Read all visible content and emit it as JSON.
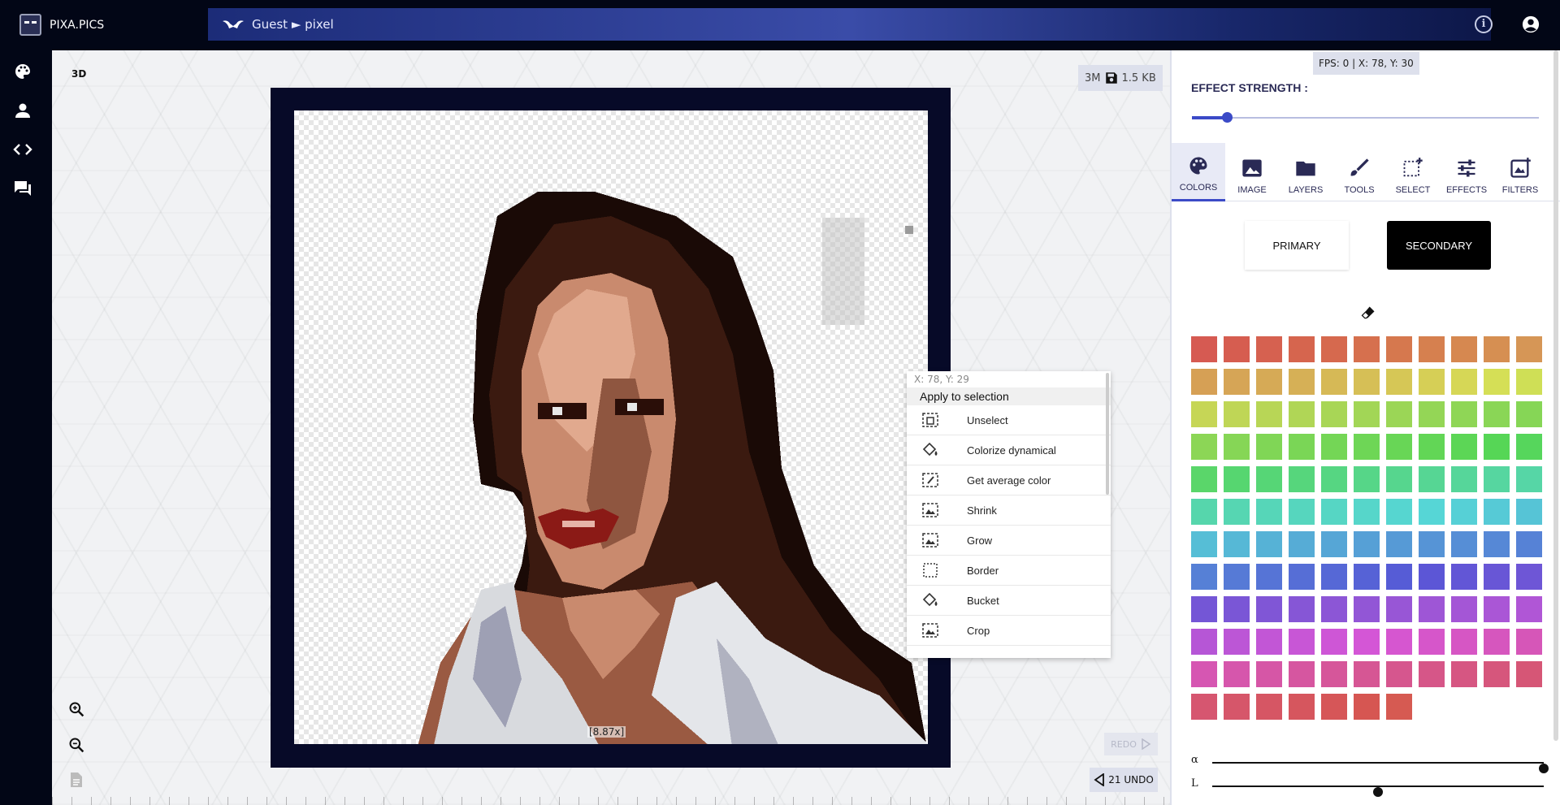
{
  "app": {
    "name": "PIXA.PICS"
  },
  "breadcrumb": {
    "text": "Guest ► pixel"
  },
  "canvas": {
    "mode_3d_label": "3D",
    "size_badge": {
      "prefix": "3M",
      "size": "1.5 KB"
    },
    "zoom_label": "[8.87x]",
    "redo_label": "REDO",
    "undo_label": "21 UNDO"
  },
  "context_menu": {
    "coords": "X: 78, Y: 29",
    "title": "Apply to selection",
    "items": [
      {
        "label": "Unselect",
        "icon": "unselect-icon"
      },
      {
        "label": "Colorize dynamical",
        "icon": "paint-bucket-icon"
      },
      {
        "label": "Get average color",
        "icon": "selection-picker-icon"
      },
      {
        "label": "Shrink",
        "icon": "image-selection-icon"
      },
      {
        "label": "Grow",
        "icon": "image-selection-icon"
      },
      {
        "label": "Border",
        "icon": "dashed-square-icon"
      },
      {
        "label": "Bucket",
        "icon": "paint-bucket-icon"
      },
      {
        "label": "Crop",
        "icon": "image-selection-icon"
      }
    ]
  },
  "panel": {
    "fps_readout": "FPS: 0 | X: 78, Y: 30",
    "effect_strength_label": "EFFECT STRENGTH :",
    "effect_strength_value": 0.1,
    "tabs": [
      {
        "label": "COLORS",
        "icon": "palette-icon",
        "active": true
      },
      {
        "label": "IMAGE",
        "icon": "image-icon",
        "active": false
      },
      {
        "label": "LAYERS",
        "icon": "folder-icon",
        "active": false
      },
      {
        "label": "TOOLS",
        "icon": "brush-icon",
        "active": false
      },
      {
        "label": "SELECT",
        "icon": "select-add-icon",
        "active": false
      },
      {
        "label": "EFFECTS",
        "icon": "tune-icon",
        "active": false
      },
      {
        "label": "FILTERS",
        "icon": "filter-add-icon",
        "active": false
      }
    ],
    "primary_label": "PRIMARY",
    "secondary_label": "SECONDARY",
    "alpha_label": "α",
    "alpha_value": 1.0,
    "lightness_label": "L",
    "lightness_value": 0.5,
    "palette": [
      "#d65a52",
      "#d65d50",
      "#d66150",
      "#d6654e",
      "#d6694e",
      "#d6704e",
      "#d6784e",
      "#d6804f",
      "#d68850",
      "#d68f52",
      "#d69656",
      "#d6a055",
      "#d6a556",
      "#d6aa56",
      "#d6b056",
      "#d6b956",
      "#d6bf56",
      "#d6c756",
      "#d6cf56",
      "#d6d756",
      "#d5df56",
      "#cfdf56",
      "#c6d656",
      "#bfd656",
      "#b8d656",
      "#b0d656",
      "#a8d656",
      "#a2d656",
      "#9bd656",
      "#94d656",
      "#8fd656",
      "#8ad656",
      "#86d656",
      "#8cd656",
      "#86d656",
      "#80d656",
      "#7ad656",
      "#74d656",
      "#6ed656",
      "#68d656",
      "#62d656",
      "#5cd656",
      "#56d656",
      "#56d65c",
      "#5ad66a",
      "#56d670",
      "#56d676",
      "#56d67c",
      "#56d682",
      "#56d688",
      "#56d68e",
      "#56d694",
      "#56d69a",
      "#56d6a0",
      "#56d6a6",
      "#56d6ac",
      "#56d6b2",
      "#56d6b8",
      "#56d6be",
      "#56d6c4",
      "#56d6ca",
      "#56d6d0",
      "#56d6d6",
      "#56d0d6",
      "#56cad6",
      "#56c4d6",
      "#56bed6",
      "#56b8d6",
      "#56b2d6",
      "#56acd6",
      "#56a6d6",
      "#56a0d6",
      "#569ad6",
      "#5694d6",
      "#568ed6",
      "#5688d6",
      "#5682d6",
      "#5680d6",
      "#567ad6",
      "#5674d6",
      "#566ed6",
      "#5668d6",
      "#5662d6",
      "#565cd6",
      "#5c56d6",
      "#6256d6",
      "#6856d6",
      "#6e56d6",
      "#7456d6",
      "#7a56d6",
      "#8056d6",
      "#8656d6",
      "#8c56d6",
      "#9256d6",
      "#9856d6",
      "#9e56d6",
      "#a456d6",
      "#aa56d6",
      "#b056d6",
      "#b656d6",
      "#bc56d6",
      "#c256d6",
      "#c856d6",
      "#ce56d6",
      "#d456d6",
      "#d656d0",
      "#d656ca",
      "#d656c4",
      "#d656be",
      "#d656b8",
      "#d656b2",
      "#d656ac",
      "#d656a6",
      "#d656a0",
      "#d6569a",
      "#d65694",
      "#d6568e",
      "#d65688",
      "#d65682",
      "#d6567c",
      "#d65676",
      "#d65670",
      "#d6566a",
      "#d65664",
      "#d6565e",
      "#d65658",
      "#d65652",
      "#d65a52"
    ]
  }
}
